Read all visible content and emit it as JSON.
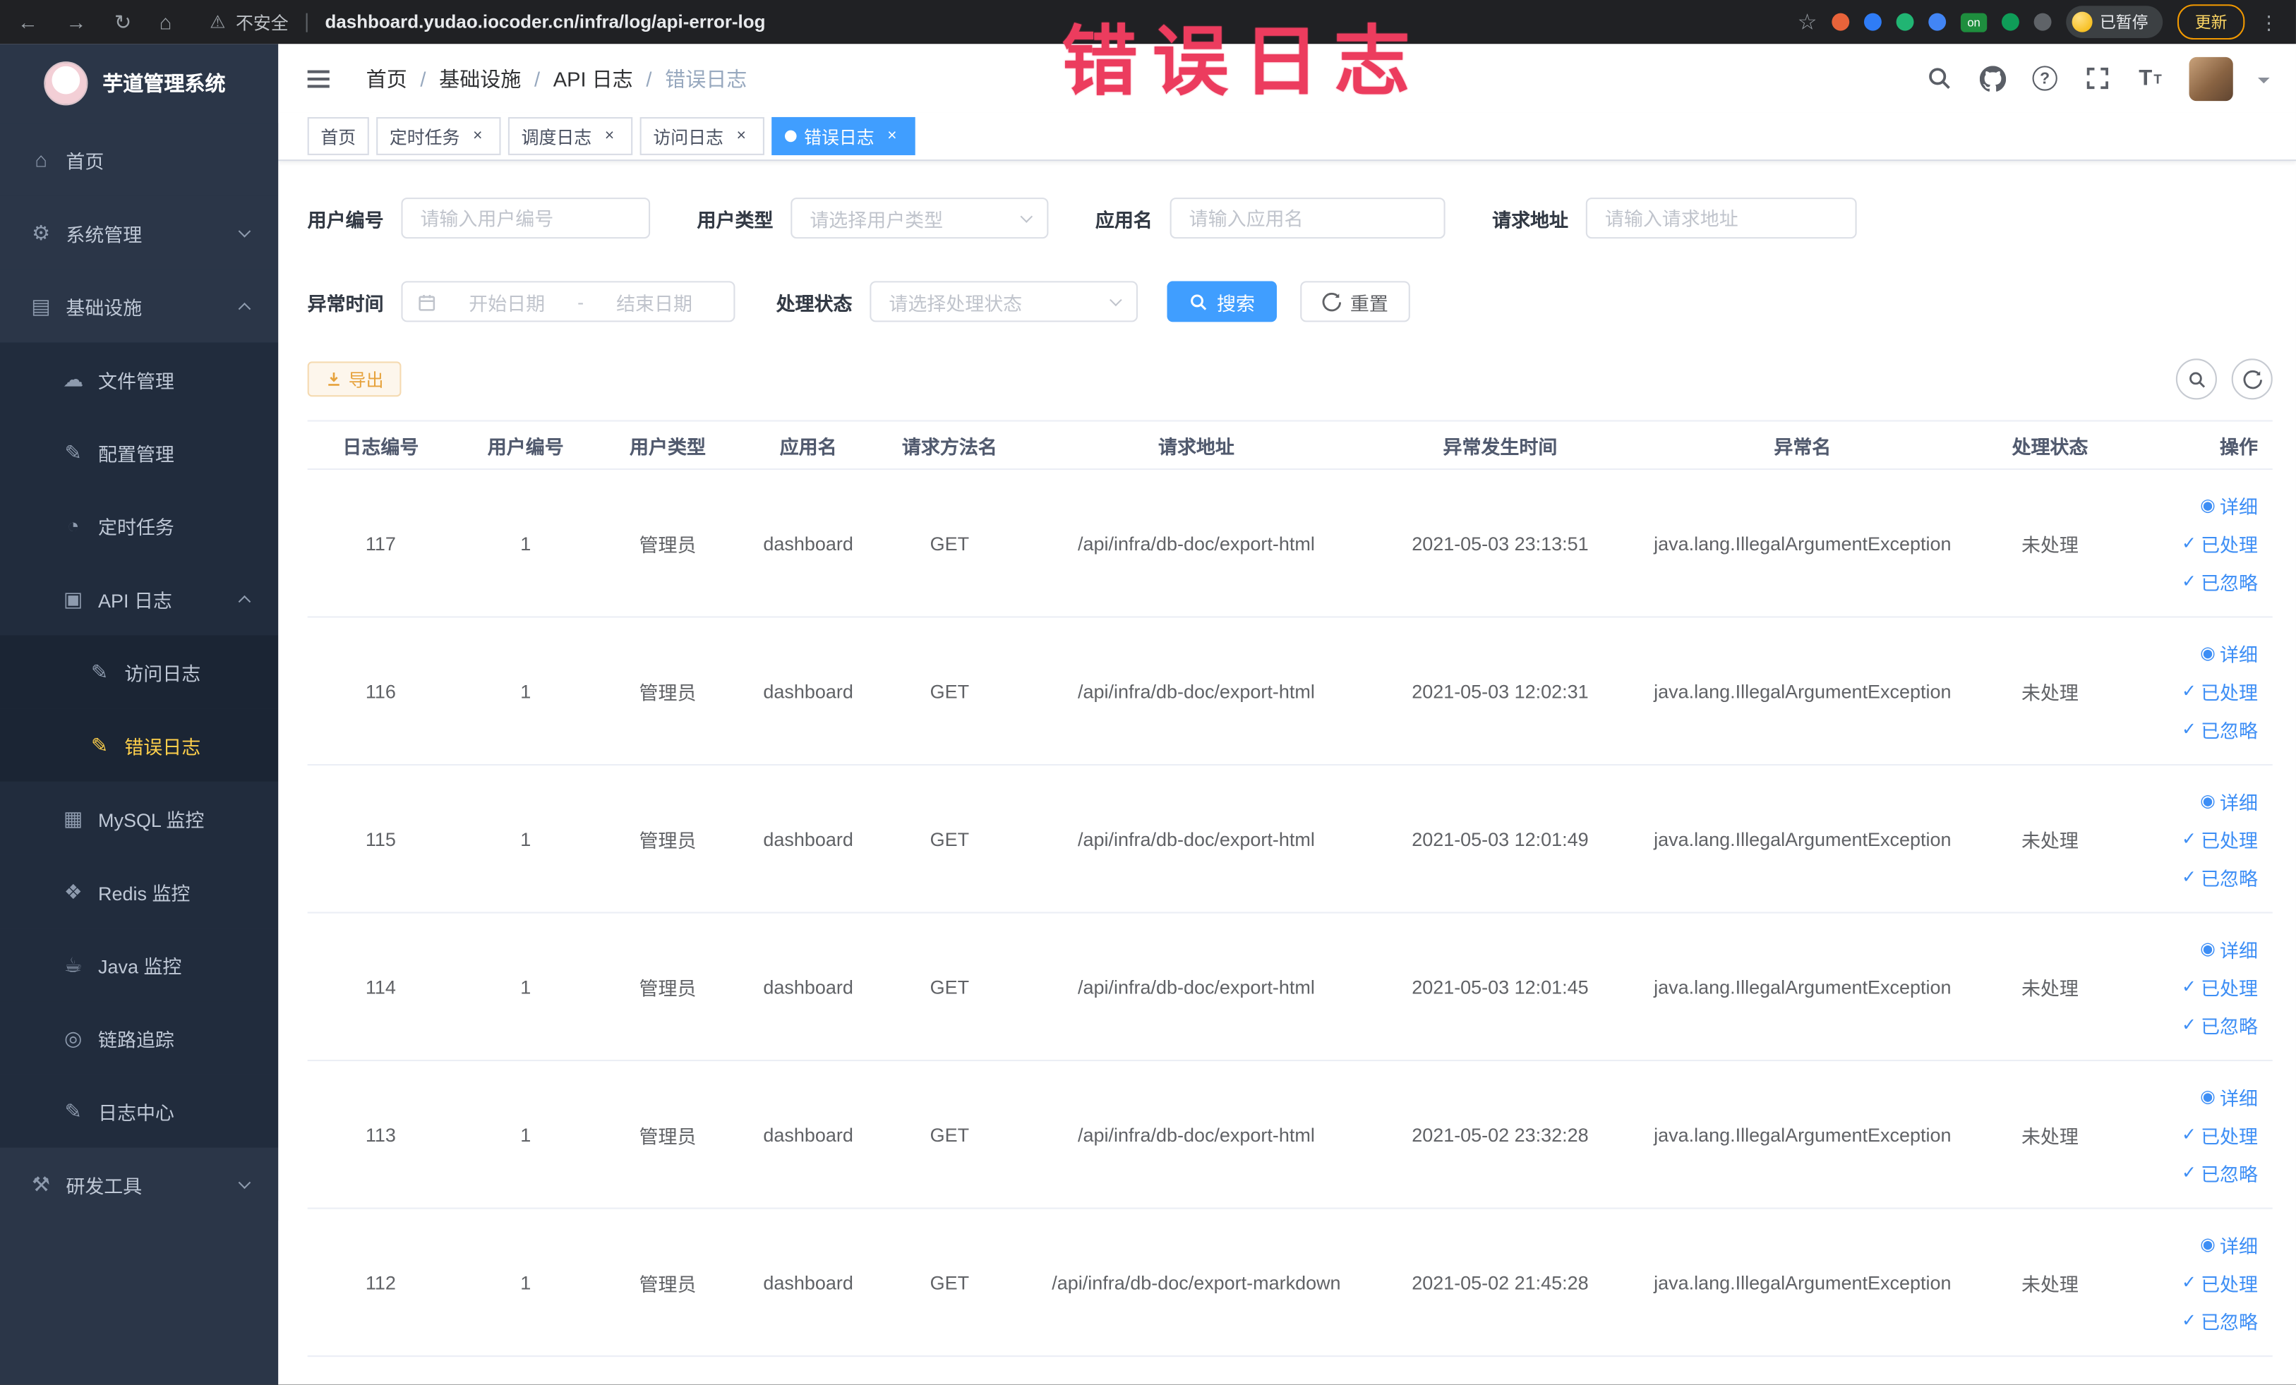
{
  "browser": {
    "icons": {
      "back": "←",
      "forward": "→",
      "reload": "↻",
      "home": "⌂",
      "star": "☆",
      "menu": "⋮",
      "warning": "⚠"
    },
    "security_label": "不安全",
    "url": "dashboard.yudao.iocoder.cn/infra/log/api-error-log",
    "on_badge": "on",
    "paused_badge": "已暂停",
    "update_button": "更新"
  },
  "annotation": {
    "text": "错误日志"
  },
  "sidebar": {
    "logo_title": "芋道管理系统",
    "items": [
      {
        "label": "首页",
        "icon": "home-icon",
        "glyph": "⌂",
        "level": 0
      },
      {
        "label": "系统管理",
        "icon": "gear-icon",
        "glyph": "⚙",
        "level": 0,
        "chevron": "down"
      },
      {
        "label": "基础设施",
        "icon": "infrastructure-icon",
        "glyph": "▤",
        "level": 0,
        "chevron": "up"
      },
      {
        "label": "文件管理",
        "icon": "file-manage-icon",
        "glyph": "☁",
        "level": 1
      },
      {
        "label": "配置管理",
        "icon": "config-manage-icon",
        "glyph": "✎",
        "level": 1
      },
      {
        "label": "定时任务",
        "icon": "scheduled-task-icon",
        "glyph": "◔",
        "level": 1
      },
      {
        "label": "API 日志",
        "icon": "api-log-icon",
        "glyph": "▣",
        "level": 1,
        "chevron": "up"
      },
      {
        "label": "访问日志",
        "icon": "access-log-icon",
        "glyph": "✎",
        "level": 2
      },
      {
        "label": "错误日志",
        "icon": "error-log-icon",
        "glyph": "✎",
        "level": 2,
        "active": true
      },
      {
        "label": "MySQL 监控",
        "icon": "mysql-monitor-icon",
        "glyph": "▦",
        "level": 1
      },
      {
        "label": "Redis 监控",
        "icon": "redis-monitor-icon",
        "glyph": "❖",
        "level": 1
      },
      {
        "label": "Java 监控",
        "icon": "java-monitor-icon",
        "glyph": "☕",
        "level": 1
      },
      {
        "label": "链路追踪",
        "icon": "trace-icon",
        "glyph": "◎",
        "level": 1
      },
      {
        "label": "日志中心",
        "icon": "log-center-icon",
        "glyph": "✎",
        "level": 1
      },
      {
        "label": "研发工具",
        "icon": "devtools-icon",
        "glyph": "⚒",
        "level": 0,
        "chevron": "down"
      }
    ]
  },
  "header": {
    "breadcrumb": [
      {
        "label": "首页"
      },
      {
        "label": "基础设施"
      },
      {
        "label": "API 日志"
      },
      {
        "label": "错误日志",
        "current": true
      }
    ],
    "help_glyph": "?",
    "font_size_glyph": "T"
  },
  "tabs": [
    {
      "label": "首页"
    },
    {
      "label": "定时任务",
      "closable": true
    },
    {
      "label": "调度日志",
      "closable": true
    },
    {
      "label": "访问日志",
      "closable": true
    },
    {
      "label": "错误日志",
      "closable": true,
      "active": true
    }
  ],
  "filters": {
    "user_id": {
      "label": "用户编号",
      "placeholder": "请输入用户编号"
    },
    "user_type": {
      "label": "用户类型",
      "placeholder": "请选择用户类型"
    },
    "app_name": {
      "label": "应用名",
      "placeholder": "请输入应用名"
    },
    "request_url": {
      "label": "请求地址",
      "placeholder": "请输入请求地址"
    },
    "exception_time": {
      "label": "异常时间",
      "start_placeholder": "开始日期",
      "separator": "-",
      "end_placeholder": "结束日期"
    },
    "process_status": {
      "label": "处理状态",
      "placeholder": "请选择处理状态"
    },
    "search_button": "搜索",
    "reset_button": "重置"
  },
  "toolbar": {
    "export_button": "导出"
  },
  "table": {
    "columns": [
      {
        "label": "日志编号"
      },
      {
        "label": "用户编号"
      },
      {
        "label": "用户类型"
      },
      {
        "label": "应用名"
      },
      {
        "label": "请求方法名"
      },
      {
        "label": "请求地址"
      },
      {
        "label": "异常发生时间"
      },
      {
        "label": "异常名"
      },
      {
        "label": "处理状态"
      },
      {
        "label": "操作"
      }
    ],
    "rows": [
      {
        "id": "117",
        "user_id": "1",
        "user_type": "管理员",
        "app_name": "dashboard",
        "method": "GET",
        "url": "/api/infra/db-doc/export-html",
        "time": "2021-05-03 23:13:51",
        "exception": "java.lang.IllegalArgumentException",
        "status": "未处理"
      },
      {
        "id": "116",
        "user_id": "1",
        "user_type": "管理员",
        "app_name": "dashboard",
        "method": "GET",
        "url": "/api/infra/db-doc/export-html",
        "time": "2021-05-03 12:02:31",
        "exception": "java.lang.IllegalArgumentException",
        "status": "未处理"
      },
      {
        "id": "115",
        "user_id": "1",
        "user_type": "管理员",
        "app_name": "dashboard",
        "method": "GET",
        "url": "/api/infra/db-doc/export-html",
        "time": "2021-05-03 12:01:49",
        "exception": "java.lang.IllegalArgumentException",
        "status": "未处理"
      },
      {
        "id": "114",
        "user_id": "1",
        "user_type": "管理员",
        "app_name": "dashboard",
        "method": "GET",
        "url": "/api/infra/db-doc/export-html",
        "time": "2021-05-03 12:01:45",
        "exception": "java.lang.IllegalArgumentException",
        "status": "未处理"
      },
      {
        "id": "113",
        "user_id": "1",
        "user_type": "管理员",
        "app_name": "dashboard",
        "method": "GET",
        "url": "/api/infra/db-doc/export-html",
        "time": "2021-05-02 23:32:28",
        "exception": "java.lang.IllegalArgumentException",
        "status": "未处理"
      },
      {
        "id": "112",
        "user_id": "1",
        "user_type": "管理员",
        "app_name": "dashboard",
        "method": "GET",
        "url": "/api/infra/db-doc/export-markdown",
        "time": "2021-05-02 21:45:28",
        "exception": "java.lang.IllegalArgumentException",
        "status": "未处理"
      }
    ],
    "row_actions": [
      {
        "label": "详细",
        "icon": "eye-icon",
        "glyph": "◉"
      },
      {
        "label": "已处理",
        "icon": "check-icon",
        "glyph": "✓"
      },
      {
        "label": "已忽略",
        "icon": "check-icon",
        "glyph": "✓"
      }
    ]
  },
  "colors": {
    "accent_blue": "#409eff",
    "active_menu_yellow": "#ffd04b",
    "warning_orange": "#e6a23c",
    "annotation_red": "#ec3c5e"
  }
}
